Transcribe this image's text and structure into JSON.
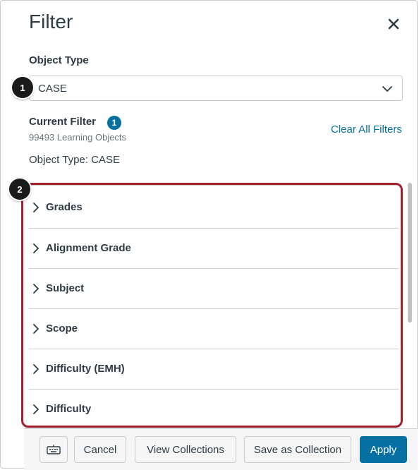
{
  "dialog": {
    "title": "Filter",
    "close_icon": "close-icon"
  },
  "object_type": {
    "label": "Object Type",
    "selected": "CASE",
    "marker": "1"
  },
  "current_filter": {
    "label": "Current Filter",
    "badge": "1",
    "count_text": "99493 Learning Objects",
    "clear_all": "Clear All Filters",
    "applied": "Object Type: CASE"
  },
  "facets": {
    "marker": "2",
    "items": [
      {
        "label": "Grades"
      },
      {
        "label": "Alignment Grade"
      },
      {
        "label": "Subject"
      },
      {
        "label": "Scope"
      },
      {
        "label": "Difficulty (EMH)"
      },
      {
        "label": "Difficulty"
      }
    ]
  },
  "footer": {
    "keyboard_icon": "keyboard-icon",
    "cancel": "Cancel",
    "view_collections": "View Collections",
    "save_as_collection": "Save as Collection",
    "apply": "Apply"
  },
  "colors": {
    "accent": "#0770a3",
    "highlight_border": "#a31e2b",
    "text": "#2d3b45"
  }
}
